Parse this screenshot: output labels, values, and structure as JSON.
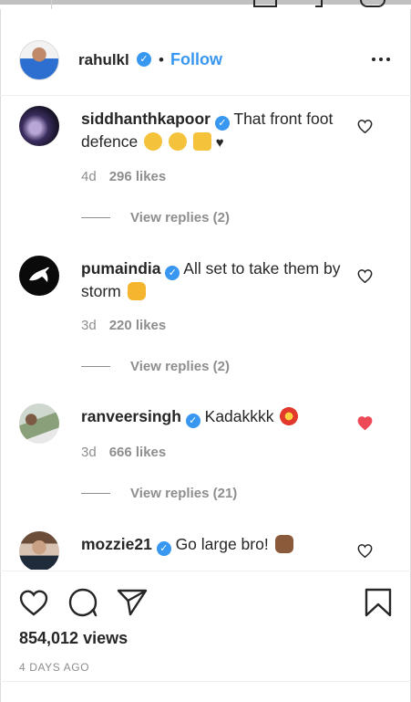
{
  "post": {
    "author": "rahulkl",
    "separator": "•",
    "follow_label": "Follow",
    "more_icon": "more-horizontal-icon"
  },
  "comments": [
    {
      "username": "siddhanthkapoor",
      "text": "That front foot defence",
      "emojis": [
        "clapping-hands",
        "hugging-face",
        "raising-hands",
        "black-heart"
      ],
      "age": "4d",
      "likes": "296 likes",
      "replies": "View replies (2)",
      "liked": false
    },
    {
      "username": "pumaindia",
      "text": "All set to take them by storm",
      "emojis": [
        "oncoming-fist"
      ],
      "age": "3d",
      "likes": "220 likes",
      "replies": "View replies (2)",
      "liked": false
    },
    {
      "username": "ranveersingh",
      "text": "Kadakkkk",
      "emojis": [
        "collision"
      ],
      "age": "3d",
      "likes": "666 likes",
      "replies": "View replies (21)",
      "liked": true
    },
    {
      "username": "mozzie21",
      "text": "Go large bro!",
      "emojis": [
        "ok-hand"
      ],
      "liked": false
    }
  ],
  "footer": {
    "views": "854,012 views",
    "date": "4 DAYS AGO"
  },
  "colors": {
    "accent": "#3897f0",
    "liked_heart": "#ed4956",
    "muted": "#8e8e8e",
    "text": "#262626"
  }
}
